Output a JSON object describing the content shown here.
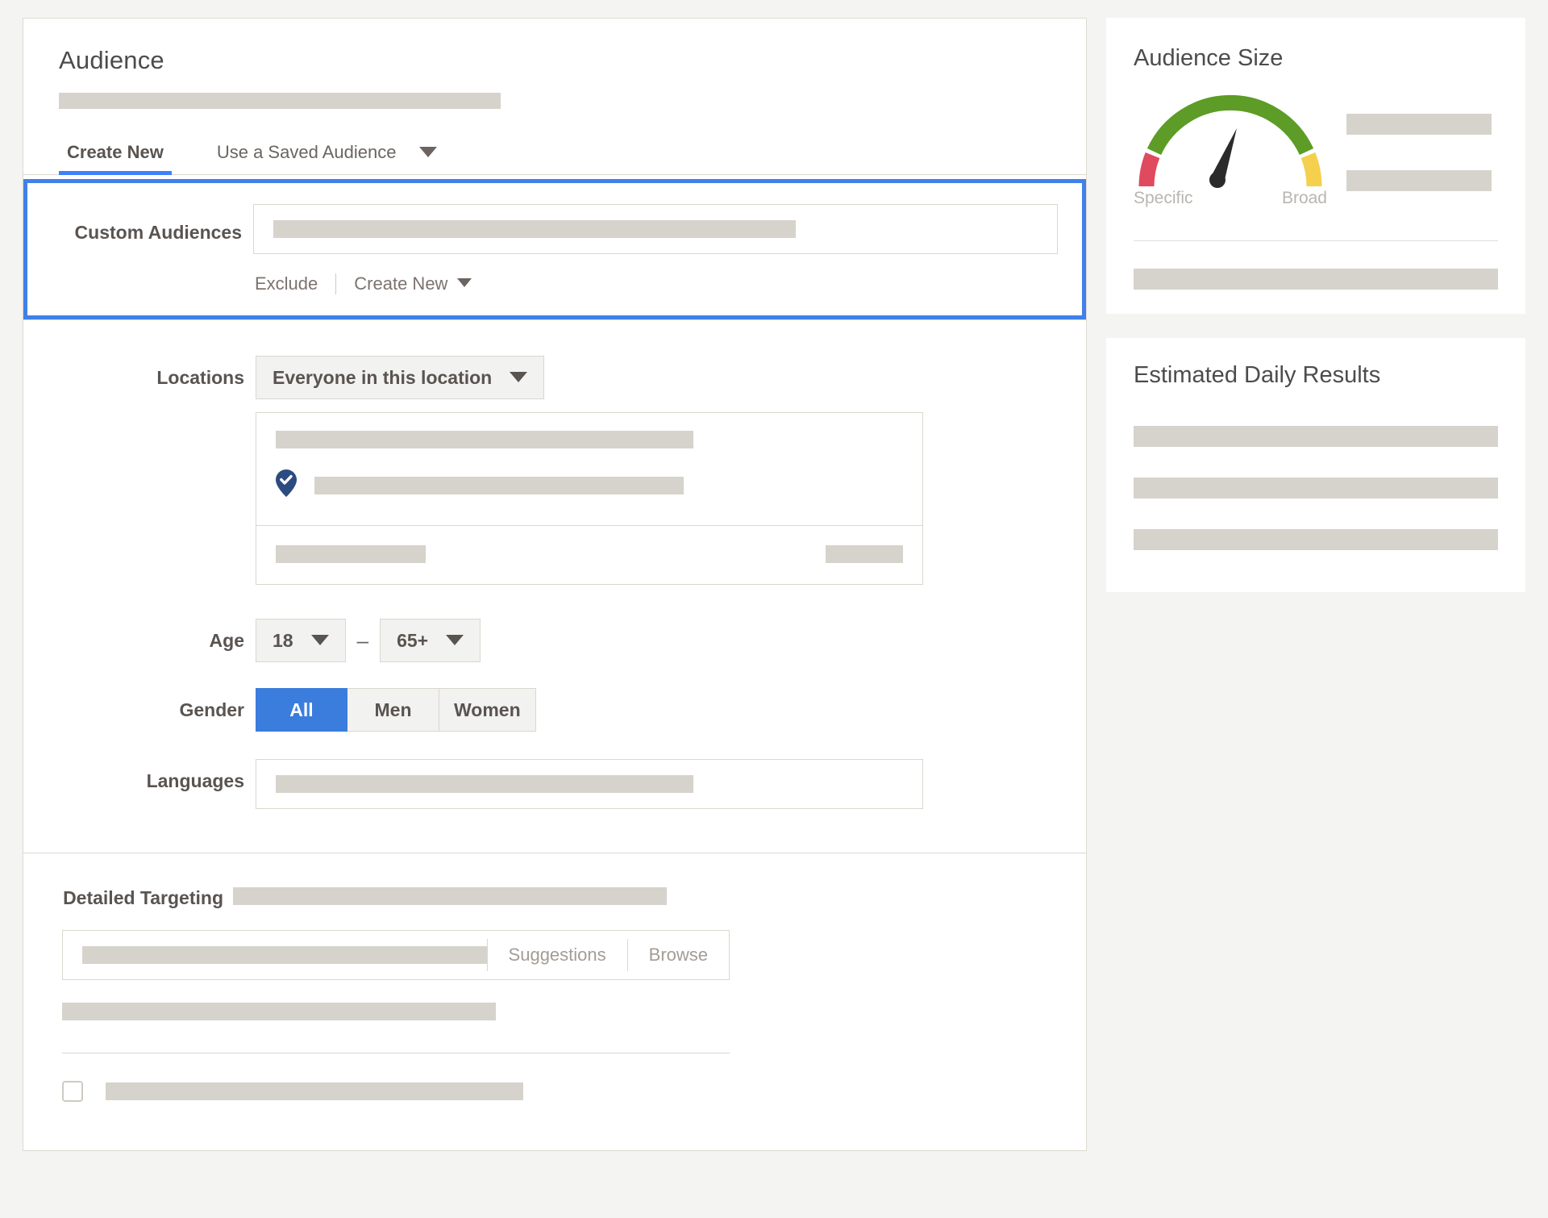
{
  "main": {
    "header": {
      "title": "Audience",
      "name_value": ""
    },
    "tabs": [
      {
        "label": "Create New",
        "active": true
      },
      {
        "label": "Use a Saved Audience",
        "active": false
      }
    ],
    "custom_audiences": {
      "label": "Custom Audiences",
      "input_value": "",
      "exclude_link": "Exclude",
      "create_new_link": "Create New",
      "highlight_color": "#4080e8"
    },
    "locations": {
      "label": "Locations",
      "scope_selected": "Everyone in this location",
      "pin_icon": "location-pin-check-icon",
      "headline_value": "",
      "entry_value": "",
      "footer_value": "",
      "footer_right_value": ""
    },
    "age": {
      "label": "Age",
      "min": "18",
      "max": "65+",
      "separator": "–"
    },
    "gender": {
      "label": "Gender",
      "options": [
        {
          "label": "All",
          "active": true
        },
        {
          "label": "Men",
          "active": false
        },
        {
          "label": "Women",
          "active": false
        }
      ],
      "active_color": "#3b7ddd"
    },
    "languages": {
      "label": "Languages",
      "value": ""
    },
    "detailed_targeting": {
      "label": "Detailed Targeting",
      "headline_value": "",
      "search_value": "",
      "suggestions_label": "Suggestions",
      "browse_label": "Browse",
      "secondary_value": "",
      "checkbox_checked": false,
      "checkbox_label_value": ""
    }
  },
  "sidebar": {
    "audience_size": {
      "title": "Audience Size",
      "gauge": {
        "specific_label": "Specific",
        "broad_label": "Broad",
        "needle_position_pct": 38,
        "segments": [
          {
            "name": "specific",
            "color": "#e04a5f",
            "span_pct": 12
          },
          {
            "name": "middle",
            "color": "#5d9c26",
            "span_pct": 76
          },
          {
            "name": "broad",
            "color": "#f5d04e",
            "span_pct": 12
          }
        ],
        "needle_color": "#2b2b2b"
      },
      "stat_1_value": "",
      "stat_2_value": "",
      "footer_value": ""
    },
    "estimated_daily_results": {
      "title": "Estimated Daily Results",
      "rows": [
        "",
        "",
        ""
      ]
    }
  },
  "chart_data": {
    "type": "gauge",
    "title": "Audience Size",
    "xlabel": "",
    "ylabel": "",
    "categories": [
      "Specific",
      "Broad"
    ],
    "values": [
      38
    ],
    "series": [
      {
        "name": "needle",
        "values": [
          38
        ]
      }
    ],
    "segments": [
      {
        "label": "Specific",
        "color": "#e04a5f",
        "start_pct": 0,
        "end_pct": 12
      },
      {
        "label": "Mid",
        "color": "#5d9c26",
        "start_pct": 12,
        "end_pct": 88
      },
      {
        "label": "Broad",
        "color": "#f5d04e",
        "start_pct": 88,
        "end_pct": 100
      }
    ],
    "ylim": [
      0,
      100
    ],
    "grid": false,
    "legend": "none"
  }
}
